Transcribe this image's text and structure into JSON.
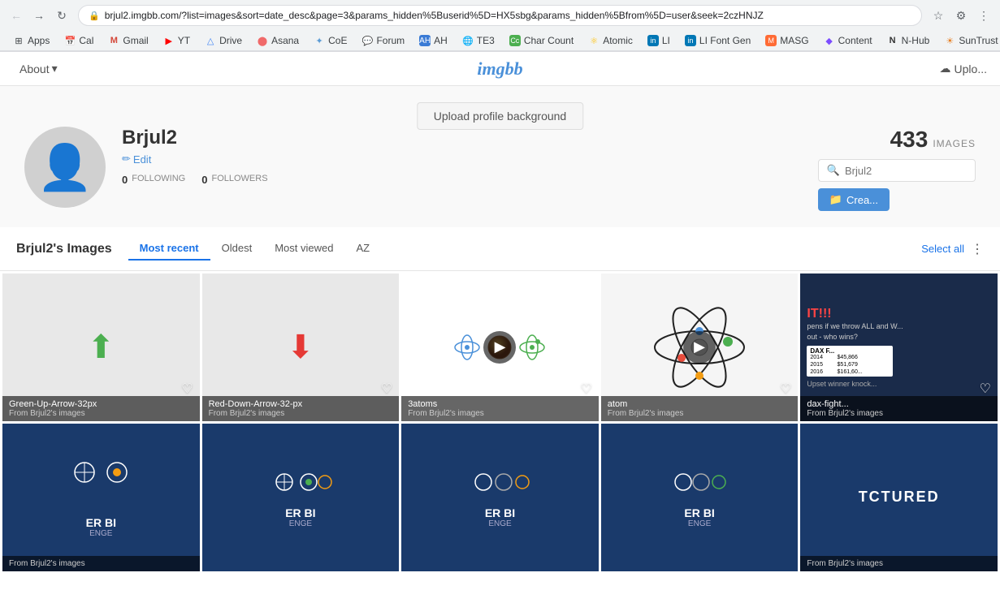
{
  "browser": {
    "address": "brjul2.imgbb.com/?list=images&sort=date_desc&page=3&params_hidden%5Buserid%5D=HX5sbg&params_hidden%5Bfrom%5D=user&seek=2czHNJZ",
    "nav_back_disabled": true,
    "nav_forward_disabled": false
  },
  "bookmarks": [
    {
      "label": "Apps",
      "icon": "⊞"
    },
    {
      "label": "Cal",
      "icon": "📅"
    },
    {
      "label": "Gmail",
      "icon": "M"
    },
    {
      "label": "YT",
      "icon": "▶"
    },
    {
      "label": "Drive",
      "icon": "△"
    },
    {
      "label": "Asana",
      "icon": "⬤"
    },
    {
      "label": "CoE",
      "icon": "✦"
    },
    {
      "label": "Forum",
      "icon": "💬"
    },
    {
      "label": "AH",
      "icon": "AH"
    },
    {
      "label": "TE3",
      "icon": "🌐"
    },
    {
      "label": "Char Count",
      "icon": "Cc"
    },
    {
      "label": "Atomic",
      "icon": "⚛"
    },
    {
      "label": "LI",
      "icon": "in"
    },
    {
      "label": "LI Font Gen",
      "icon": "in"
    },
    {
      "label": "MASG",
      "icon": "M"
    },
    {
      "label": "Content",
      "icon": "◆"
    },
    {
      "label": "N-Hub",
      "icon": "N"
    },
    {
      "label": "SunTrust",
      "icon": "☀"
    }
  ],
  "nav": {
    "about_label": "About",
    "about_arrow": "▾",
    "logo": "imgbb",
    "upload_label": "Uplo..."
  },
  "profile": {
    "upload_bg_label": "Upload profile background",
    "username": "Brjul2",
    "edit_label": "Edit",
    "following_count": "0",
    "following_label": "FOLLOWING",
    "followers_count": "0",
    "followers_label": "FOLLOWERS",
    "image_count": "433",
    "images_label": "IMAGES",
    "search_placeholder": "Brjul2",
    "create_album_label": "Crea..."
  },
  "images_section": {
    "title": "Brjul2's Images",
    "tabs": [
      {
        "label": "Most recent",
        "active": true
      },
      {
        "label": "Oldest",
        "active": false
      },
      {
        "label": "Most viewed",
        "active": false
      },
      {
        "label": "AZ",
        "active": false
      }
    ],
    "select_all_label": "Select all"
  },
  "images": [
    {
      "id": "green-arrow",
      "title": "Green-Up-Arrow-32px",
      "subtitle": "From Brjul2's images",
      "type": "arrow-up",
      "bg": "#e8e8e8"
    },
    {
      "id": "red-arrow",
      "title": "Red-Down-Arrow-32-px",
      "subtitle": "From Brjul2's images",
      "type": "arrow-down",
      "bg": "#e8e8e8"
    },
    {
      "id": "3atoms",
      "title": "3atoms",
      "subtitle": "From Brjul2's images",
      "type": "atoms",
      "bg": "#fff",
      "has_play": true
    },
    {
      "id": "atom",
      "title": "atom",
      "subtitle": "From Brjul2's images",
      "type": "atom-single",
      "bg": "#fff",
      "has_play": true
    },
    {
      "id": "dax-fight",
      "title": "dax-fight...",
      "subtitle": "From Brjul2's images",
      "type": "dax",
      "bg": "#1a2b4a"
    },
    {
      "id": "bi1",
      "title": "",
      "subtitle": "From Brjul2's images",
      "type": "bi-blue",
      "bg": "#1a3a6b",
      "main_text": "ER BI",
      "sub_text": "ENGE"
    },
    {
      "id": "bi2",
      "title": "",
      "subtitle": "",
      "type": "bi-blue",
      "bg": "#1a3a6b",
      "main_text": "ER BI",
      "sub_text": "ENGE"
    },
    {
      "id": "bi3",
      "title": "",
      "subtitle": "",
      "type": "bi-blue",
      "bg": "#1a3a6b",
      "main_text": "ER BI",
      "sub_text": "ENGE"
    },
    {
      "id": "bi4",
      "title": "",
      "subtitle": "",
      "type": "bi-blue",
      "bg": "#1a3a6b",
      "main_text": "ER BI",
      "sub_text": "ENGE"
    },
    {
      "id": "tctured",
      "title": "",
      "subtitle": "From Brjul2's images",
      "type": "tctured",
      "bg": "#1a3a6b",
      "main_text": "TCTURED"
    }
  ]
}
